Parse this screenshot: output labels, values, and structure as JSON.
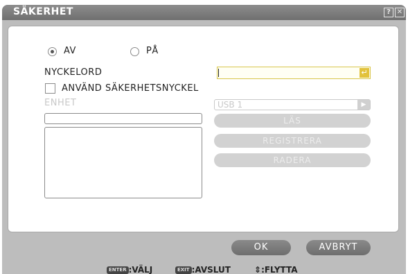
{
  "window": {
    "title": "SÄKERHET",
    "help_icon": "?",
    "close_icon": "✕"
  },
  "security_mode": {
    "options": [
      {
        "label": "AV",
        "selected": true
      },
      {
        "label": "PÅ",
        "selected": false
      }
    ]
  },
  "keyword": {
    "label": "NYCKELORD",
    "value": "",
    "enter_icon": "↵"
  },
  "security_key": {
    "label": "ANVÄND SÄKERHETSNYCKEL",
    "checked": false
  },
  "device": {
    "label": "ENHET",
    "selected": "USB 1"
  },
  "actions": {
    "read": "LÄS",
    "register": "REGISTRERA",
    "delete": "RADERA"
  },
  "footer": {
    "ok": "OK",
    "cancel": "AVBRYT"
  },
  "help_bar": {
    "enter_key": "ENTER",
    "enter_action": ":VÄLJ",
    "exit_key": "EXIT",
    "exit_action": ":AVSLUT",
    "move_symbol": "⇕",
    "move_action": ":FLYTTA"
  }
}
